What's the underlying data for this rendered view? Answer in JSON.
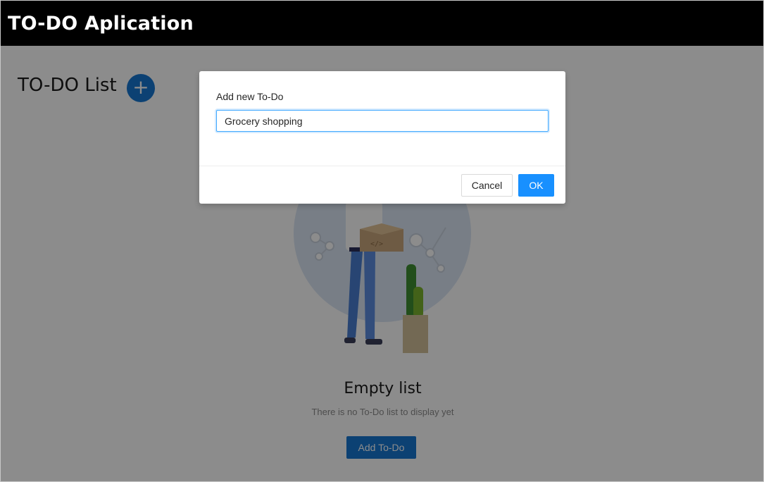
{
  "header": {
    "title": "TO-DO Aplication"
  },
  "main": {
    "list_title": "TO-DO List",
    "add_icon_glyph": "+",
    "empty_title": "Empty list",
    "empty_description": "There is no To-Do list to display yet",
    "add_button_label": "Add To-Do"
  },
  "modal": {
    "label": "Add new To-Do",
    "input_value": "Grocery shopping",
    "cancel_label": "Cancel",
    "ok_label": "OK"
  },
  "icons": {
    "add": "plus-icon",
    "illustration": "empty-state-illustration"
  },
  "colors": {
    "header_bg": "#000000",
    "primary": "#1677d2",
    "ok_button": "#1890ff"
  }
}
